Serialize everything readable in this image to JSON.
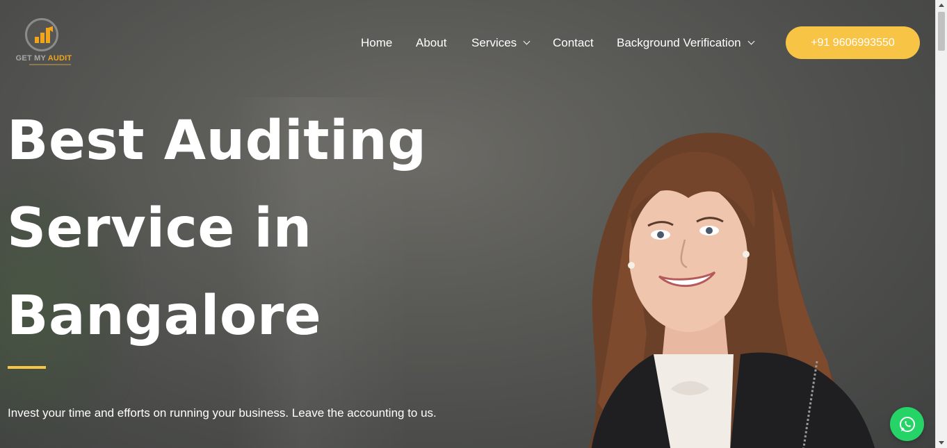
{
  "logo": {
    "text_get": "GET MY ",
    "text_audit": "AUDIT",
    "icon": "bar-chart-logo-icon",
    "colors": {
      "accent": "#f2a51a",
      "ring": "#8b8b8b"
    }
  },
  "nav": {
    "items": [
      {
        "label": "Home",
        "has_dropdown": false
      },
      {
        "label": "About",
        "has_dropdown": false
      },
      {
        "label": "Services",
        "has_dropdown": true
      },
      {
        "label": "Contact",
        "has_dropdown": false
      },
      {
        "label": "Background Verification",
        "has_dropdown": true
      }
    ],
    "dropdown_icon": "chevron-down-icon"
  },
  "cta": {
    "phone_label": "+91 9606993550",
    "color": "#f8c446"
  },
  "hero": {
    "headline_lines": [
      "Best Auditing",
      "Service in",
      "Bangalore"
    ],
    "subtitle": "Invest your time and efforts on running your business. Leave the accounting to us.",
    "accent_color": "#f8c446",
    "image": "smiling-woman-portrait"
  },
  "floating": {
    "whatsapp_icon": "whatsapp-icon",
    "whatsapp_color": "#25d366"
  },
  "scrollbar": {
    "up_icon": "scroll-up-arrow-icon",
    "down_icon": "scroll-down-arrow-icon"
  }
}
